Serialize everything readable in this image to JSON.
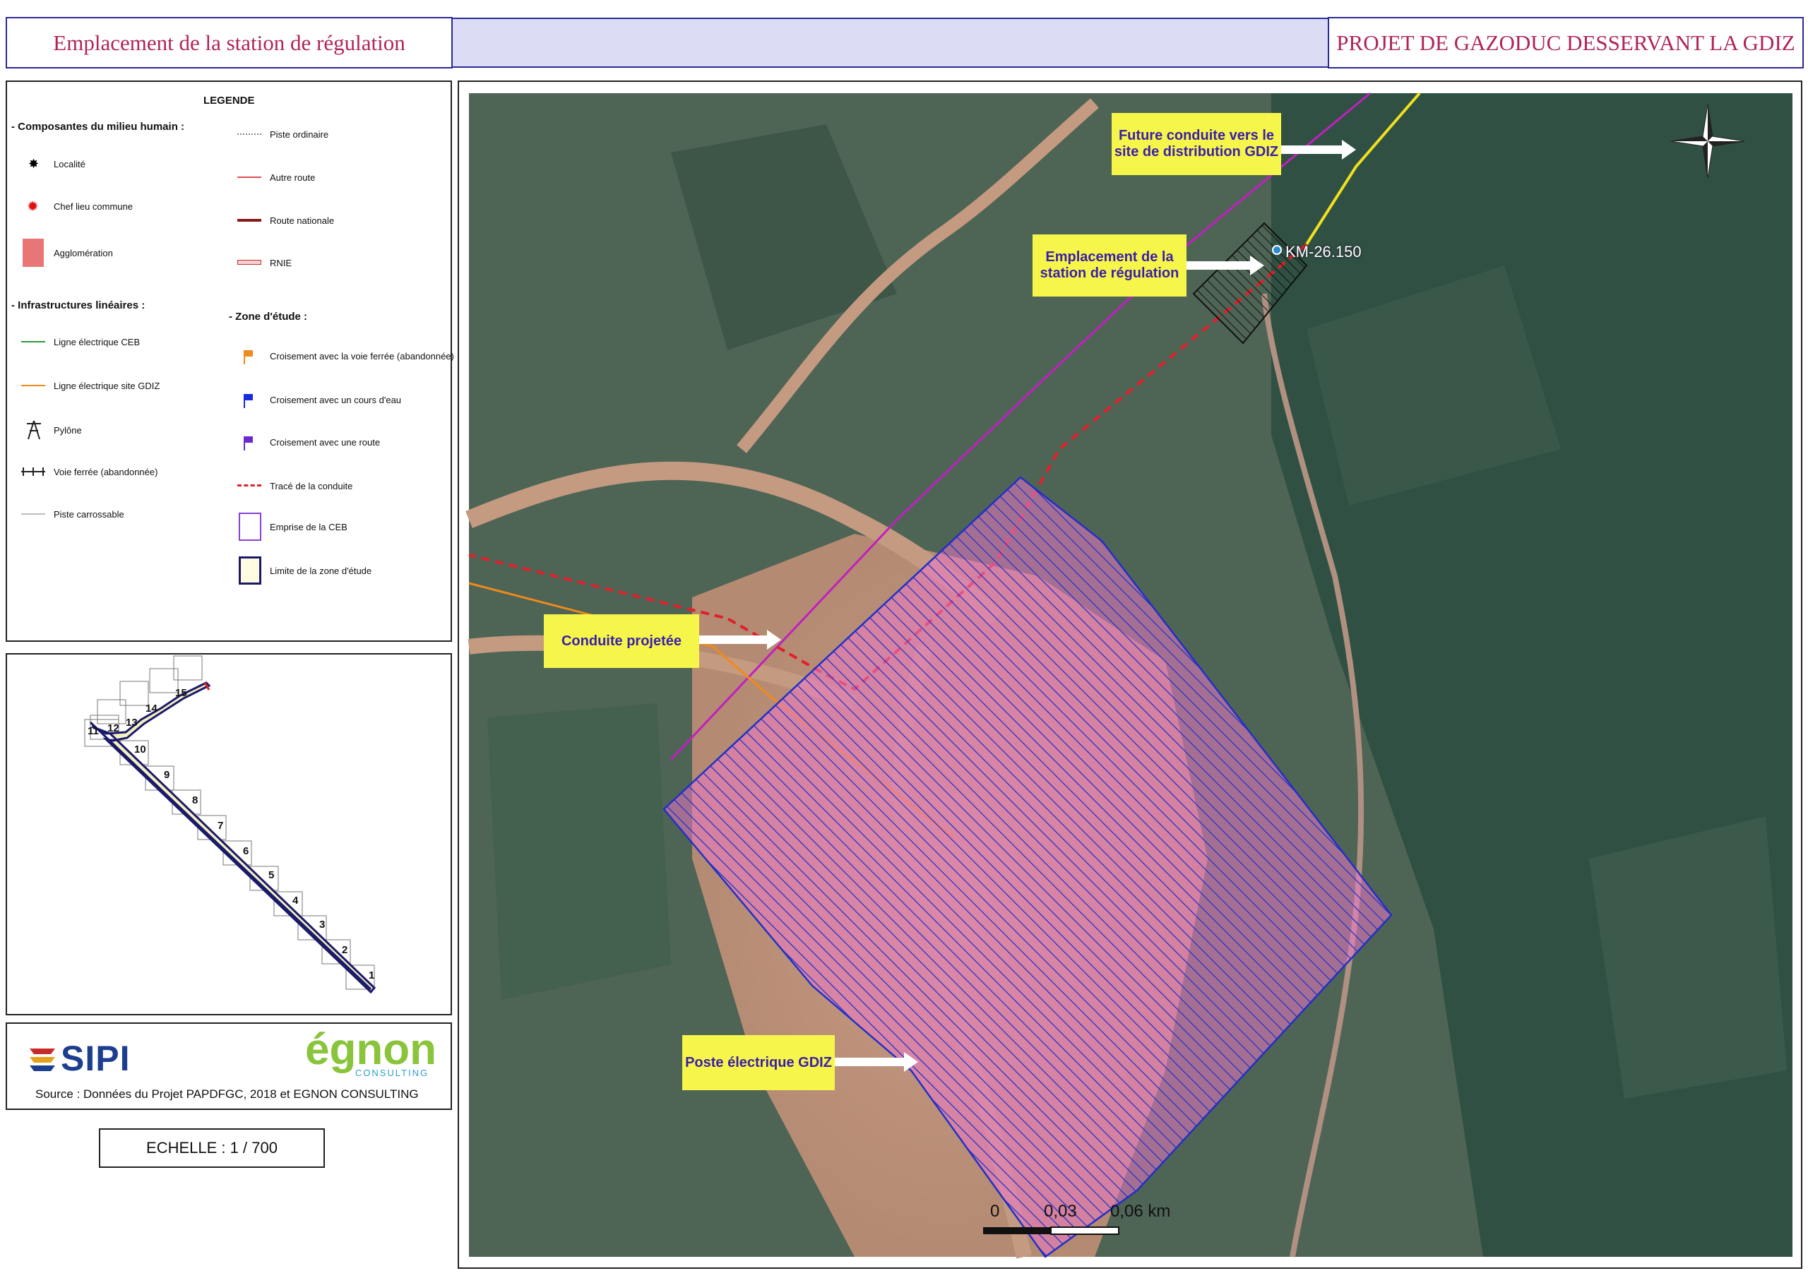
{
  "header": {
    "left_title": "Emplacement de la station de régulation",
    "right_title": "PROJET DE GAZODUC DESSERVANT LA GDIZ"
  },
  "legend": {
    "title": "LEGENDE",
    "sections": {
      "human": "- Composantes du milieu humain :",
      "linear": "- Infrastructures linéaires  :",
      "study": "- Zone d'étude :"
    },
    "items": {
      "localite": "Localité",
      "chef_lieu": "Chef lieu commune",
      "agglomeration": "Agglomération",
      "ligne_ceb": "Ligne électrique CEB",
      "ligne_gdiz": "Ligne électrique site GDIZ",
      "pylone": "Pylône",
      "voie_ferree": "Voie ferrée (abandonnée)",
      "piste_carrossable": "Piste carrossable",
      "piste_ordinaire": "Piste ordinaire",
      "autre_route": "Autre route",
      "route_nationale": "Route nationale",
      "rnie": "RNIE",
      "crois_voie": "Croisement avec la voie ferrée (abandonnée)",
      "crois_eau": "Croisement avec un cours d'eau",
      "crois_route": "Croisement avec une route",
      "trace": "Tracé de la conduite",
      "emprise": "Emprise de la CEB",
      "limite": "Limite de la zone d'étude"
    }
  },
  "index_map": {
    "sheets": [
      "1",
      "2",
      "3",
      "4",
      "5",
      "6",
      "7",
      "8",
      "9",
      "10",
      "11",
      "12",
      "13",
      "14",
      "15"
    ]
  },
  "logos": {
    "sipi": "SIPI",
    "egnon": "égnon",
    "egnon_sub": "CONSULTING",
    "source": "Source : Données du Projet PAPDFGC,  2018 et EGNON CONSULTING"
  },
  "scale_text": "ECHELLE : 1 / 700",
  "map": {
    "callouts": {
      "future": "Future conduite vers le site de distribution GDIZ",
      "station": "Emplacement de la station de régulation",
      "conduite": "Conduite projetée",
      "poste": "Poste électrique GDIZ"
    },
    "km_label": "KM-26.150",
    "scalebar": {
      "zero": "0",
      "mid": "0,03",
      "end": "0,06 km"
    }
  },
  "colors": {
    "header_text": "#b0245a",
    "frame": "#2a2a9a",
    "callout_bg": "#f6f64a",
    "callout_text": "#3a1fa8",
    "pipeline": "#e0202a",
    "gdiz_line": "#f08a1c",
    "ceb_line": "#c020c0"
  }
}
